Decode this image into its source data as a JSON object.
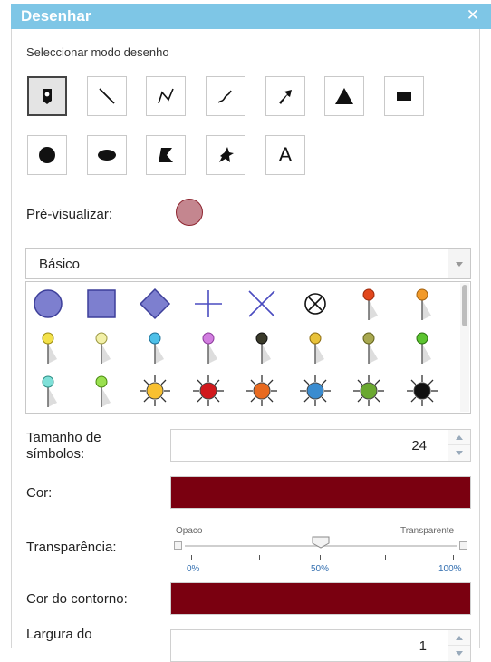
{
  "window": {
    "title": "Desenhar",
    "close_glyph": "✕"
  },
  "mode": {
    "label": "Seleccionar modo desenho",
    "tools": [
      {
        "name": "point",
        "icon": "point-pin-icon",
        "active": true
      },
      {
        "name": "line",
        "icon": "line-icon"
      },
      {
        "name": "polyline",
        "icon": "polyline-icon"
      },
      {
        "name": "freehand-polyline",
        "icon": "freehand-line-icon"
      },
      {
        "name": "arrow",
        "icon": "arrow-icon"
      },
      {
        "name": "triangle",
        "icon": "triangle-icon"
      },
      {
        "name": "rectangle",
        "icon": "rectangle-icon"
      },
      {
        "name": "circle",
        "icon": "circle-icon"
      },
      {
        "name": "ellipse",
        "icon": "ellipse-icon"
      },
      {
        "name": "polygon",
        "icon": "polygon-icon"
      },
      {
        "name": "freehand-polygon",
        "icon": "freehand-polygon-icon"
      },
      {
        "name": "text",
        "icon": "text-icon",
        "text": "A"
      }
    ]
  },
  "preview": {
    "label": "Pré-visualizar:",
    "fill": "#c4868f",
    "outline": "#8e2530"
  },
  "symbol_set": {
    "selected": "Básico"
  },
  "symbols": [
    "circle-icon",
    "square-icon",
    "diamond-icon",
    "cross-icon",
    "x-icon",
    "circle-x-icon",
    "pushpin-red-icon",
    "pushpin-orange-icon",
    "pushpin-yellow-icon",
    "pushpin-lightyellow-icon",
    "pushpin-cyan-icon",
    "pushpin-violet-icon",
    "pushpin-black-icon",
    "pushpin-gold-icon",
    "pushpin-olive-icon",
    "pushpin-green-icon",
    "pushpin-aqua-icon",
    "pushpin-lime-icon",
    "sun-yellow-icon",
    "sun-red-icon",
    "sun-orange-icon",
    "sun-blue-icon",
    "sun-green-icon",
    "sun-black-icon"
  ],
  "size": {
    "label": "Tamanho de símbolos:",
    "value": "24"
  },
  "color": {
    "label": "Cor:",
    "value": "#7a0010"
  },
  "transparency": {
    "label": "Transparência:",
    "min_label": "Opaco",
    "max_label": "Transparente",
    "value_percent": 50,
    "ticks": [
      "0%",
      "50%",
      "100%"
    ]
  },
  "outline_color": {
    "label": "Cor do contorno:",
    "value": "#7a0010"
  },
  "outline_width": {
    "label": "Largura do",
    "value": "1"
  }
}
